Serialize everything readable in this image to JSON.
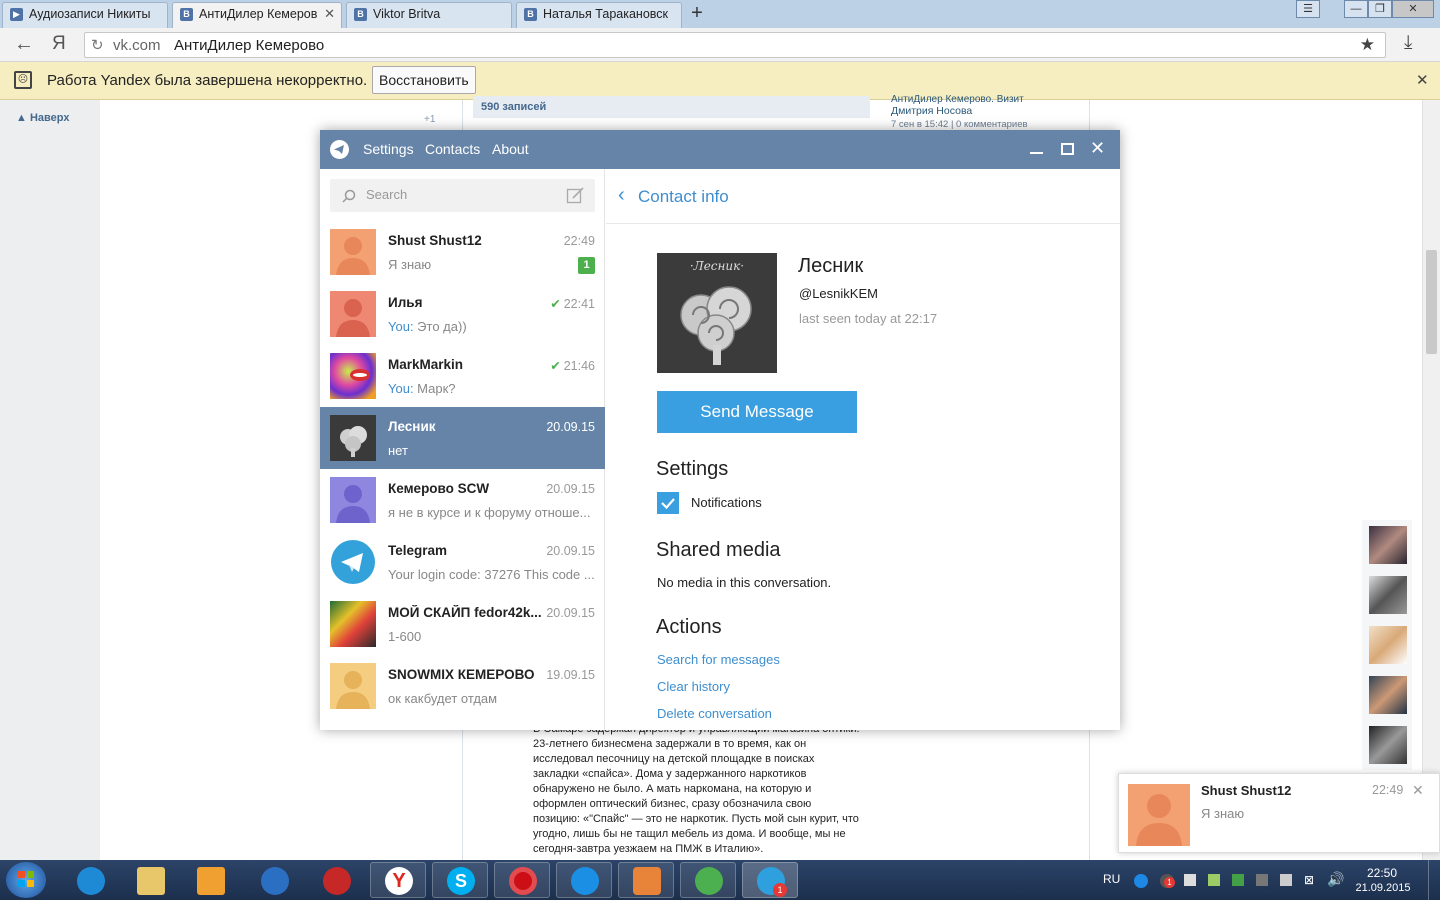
{
  "browser": {
    "tabs": [
      {
        "label": "Аудиозаписи Никиты",
        "active": false
      },
      {
        "label": "АнтиДилер Кемерово",
        "active": true
      },
      {
        "label": "Viktor Britva",
        "active": false
      },
      {
        "label": "Наталья Таракановск",
        "active": false
      }
    ],
    "url_domain": "vk.com",
    "url_title": "АнтиДилер Кемерово",
    "notify_text": "Работа Yandex была завершена некорректно.",
    "restore_label": "Восстановить"
  },
  "vk_page": {
    "nav_top": "Наверх",
    "posts_count": "590 записей",
    "like_count": "+1",
    "side_title": "АнтиДилер Кемерово. Визит",
    "side_author": "Дмитрия Носова",
    "side_meta": "7 сен в 15:42 | 0 комментариев",
    "article_lines": [
      "В Самаре задержан директор и управляющий магазина оптики.",
      "23-летнего бизнесмена задержали в то время, как он",
      "исследовал песочницу на детской площадке в поисках",
      "закладки «спайса». Дома у задержанного наркотиков",
      "обнаружено не было. А мать наркомана, на которую и",
      "оформлен оптический бизнес, сразу обозначила свою",
      "позицию: «\"Спайс\" — это не наркотик. Пусть мой сын курит, что",
      "угодно, лишь бы не тащил мебель из дома. И вообще, мы не",
      "сегодня-завтра уезжаем на ПМЖ в Италию»."
    ]
  },
  "telegram": {
    "menu": [
      "Settings",
      "Contacts",
      "About"
    ],
    "search_placeholder": "Search",
    "chats": [
      {
        "name": "Shust Shust12",
        "time": "22:49",
        "you": "",
        "msg": "Я знаю",
        "badge": "1",
        "check": false,
        "avatar": "default-orange",
        "selected": false
      },
      {
        "name": "Илья",
        "time": "22:41",
        "you": "You:",
        "msg": " Это да))",
        "badge": "",
        "check": true,
        "avatar": "default-red",
        "selected": false
      },
      {
        "name": "MarkMarkin",
        "time": "21:46",
        "you": "You:",
        "msg": " Марк?",
        "badge": "",
        "check": true,
        "avatar": "psychedelic",
        "selected": false
      },
      {
        "name": "Лесник",
        "time": "20.09.15",
        "you": "",
        "msg": "нет",
        "badge": "",
        "check": false,
        "avatar": "lesnik-tree",
        "selected": true
      },
      {
        "name": "Кемерово SCW",
        "time": "20.09.15",
        "you": "",
        "msg": "я не в курсе и к форуму отноше...",
        "badge": "",
        "check": false,
        "avatar": "default-violet",
        "selected": false
      },
      {
        "name": "Telegram",
        "time": "20.09.15",
        "you": "",
        "msg": "Your login code: 37276 This code ...",
        "badge": "",
        "check": false,
        "avatar": "telegram-logo",
        "selected": false
      },
      {
        "name": "МОЙ СКАЙП fedor42k...",
        "time": "20.09.15",
        "you": "",
        "msg": "1-600",
        "badge": "",
        "check": false,
        "avatar": "colorful-poster",
        "selected": false
      },
      {
        "name": "SNOWMIX КЕМЕРОВО",
        "time": "19.09.15",
        "you": "",
        "msg": "ок какбудет отдам",
        "badge": "",
        "check": false,
        "avatar": "default-yellow",
        "selected": false
      }
    ],
    "contact": {
      "header": "Contact info",
      "name": "Лесник",
      "username": "@LesnikKEM",
      "last_seen": "last seen today at 22:17",
      "avatar_caption": "·Лесник·",
      "send_button": "Send Message",
      "settings_title": "Settings",
      "notifications_label": "Notifications",
      "notifications_checked": true,
      "shared_title": "Shared media",
      "shared_empty": "No media in this conversation.",
      "actions_title": "Actions",
      "actions": [
        "Search for messages",
        "Clear history",
        "Delete conversation"
      ]
    }
  },
  "toast": {
    "name": "Shust Shust12",
    "time": "22:49",
    "msg": "Я знаю"
  },
  "taskbar": {
    "lang": "RU",
    "time": "22:50",
    "date": "21.09.2015",
    "tray_badge": "1",
    "telegram_badge": "1"
  },
  "colors": {
    "telegram_header": "#6584a7",
    "accent": "#3e8ecf",
    "send_button": "#3a9fe0",
    "unread_badge": "#4db04d"
  }
}
